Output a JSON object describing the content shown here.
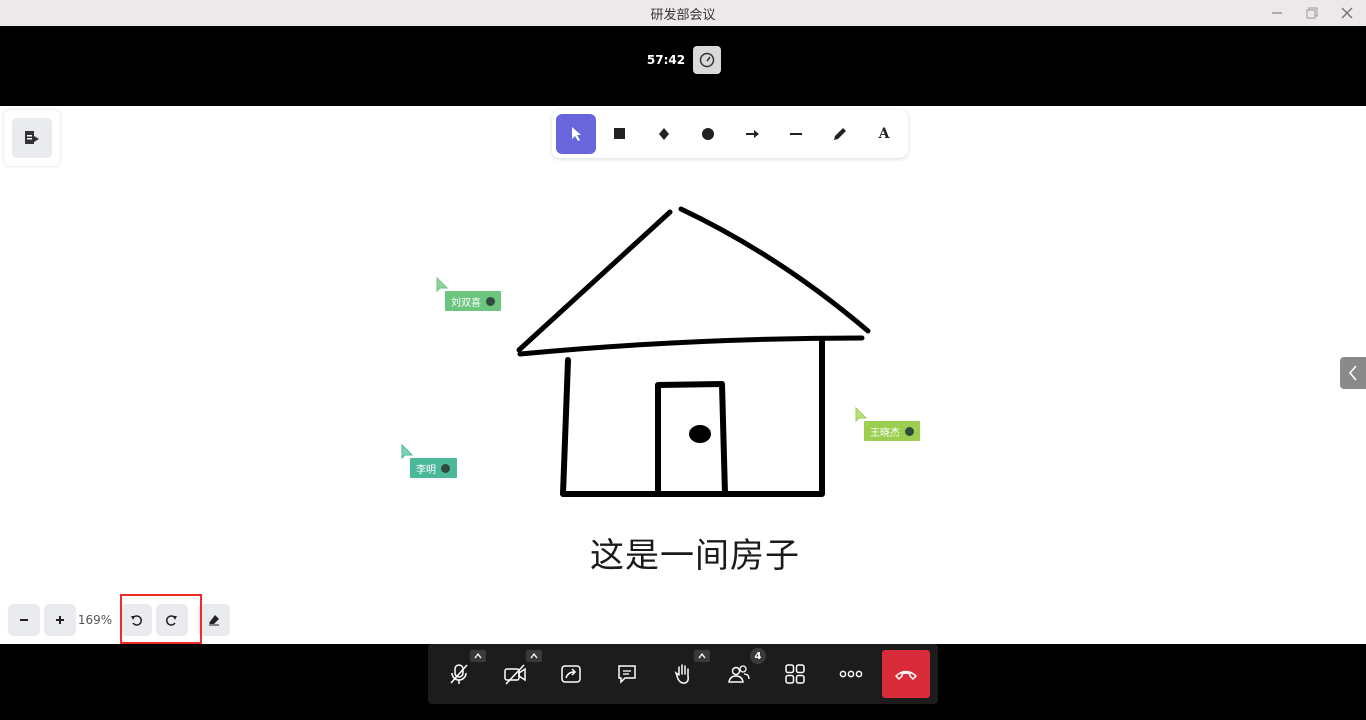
{
  "window": {
    "title": "研发部会议"
  },
  "meeting": {
    "timer": "57:42"
  },
  "whiteboard": {
    "caption": "这是一间房子",
    "cursors": [
      {
        "name": "刘双喜",
        "color": "#6cc57c"
      },
      {
        "name": "王晓杰",
        "color": "#9ccf4f"
      },
      {
        "name": "李明",
        "color": "#4bb89a"
      }
    ],
    "zoom": "169%",
    "tools": [
      "select-icon",
      "rectangle-icon",
      "diamond-icon",
      "ellipse-icon",
      "arrow-icon",
      "line-icon",
      "pencil-icon",
      "text-icon"
    ]
  },
  "toolbar": {
    "participant_count": "4",
    "text_tool_label": "A"
  },
  "colors": {
    "accent": "#6965db",
    "hangup": "#d92c3b",
    "highlight": "#ef2b2b"
  }
}
